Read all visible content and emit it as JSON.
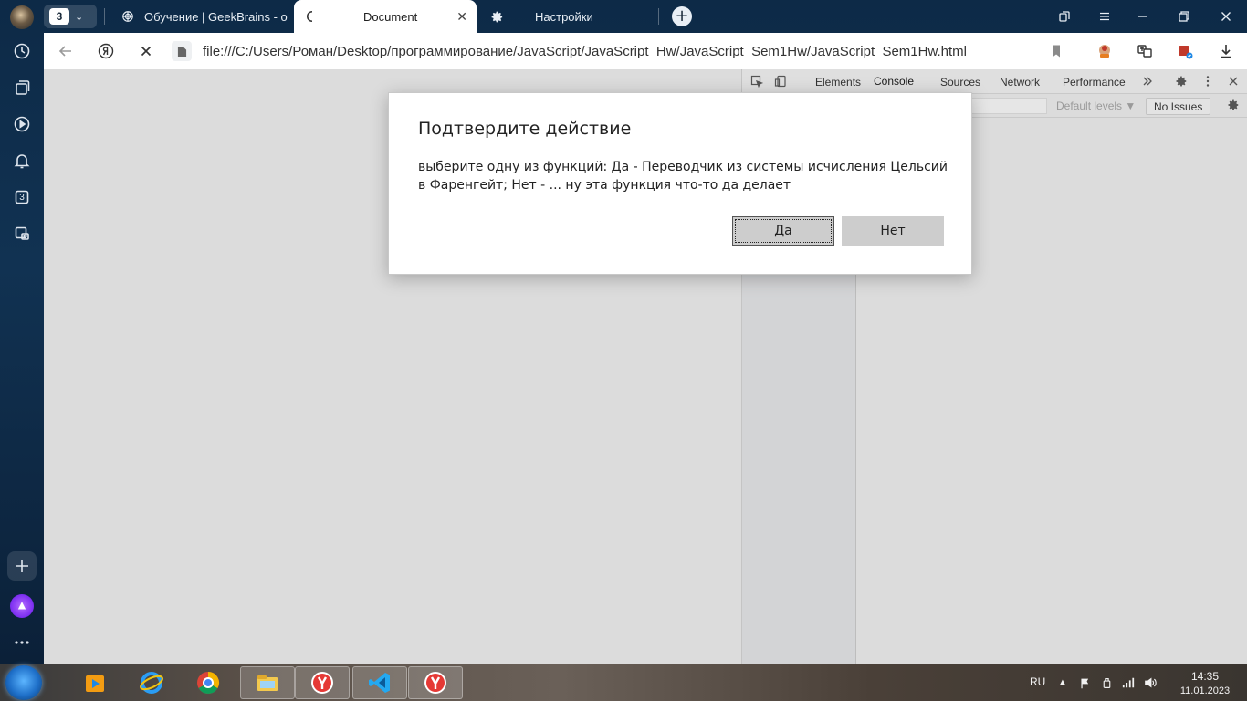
{
  "browser": {
    "tab_count": "3",
    "tabs": [
      {
        "label": "Обучение | GeekBrains - о"
      },
      {
        "label": "Document"
      },
      {
        "label": "Настройки"
      }
    ],
    "url": "file:///C:/Users/Роман/Desktop/программирование/JavaScript/JavaScript_Hw/JavaScript_Sem1Hw/JavaScript_Sem1Hw.html",
    "sidebar_counter": "3"
  },
  "devtools": {
    "tabs": [
      "Elements",
      "Console",
      "Sources",
      "Network",
      "Performance"
    ],
    "active_tab": "Console",
    "levels": "Default levels ▼",
    "issues": "No Issues"
  },
  "dialog": {
    "title": "Подтвердите действие",
    "message": "выберите одну из функций: Да - Переводчик из системы исчисления Цельсий в Фаренгейт; Нет - ... ну эта функция что-то да делает",
    "yes_label": "Да",
    "no_label": "Нет"
  },
  "taskbar": {
    "language": "RU",
    "time": "14:35",
    "date": "11.01.2023"
  },
  "colors": {
    "accent": "#1a73e8",
    "frame": "#113252",
    "page_bg": "#dcdcdc"
  }
}
